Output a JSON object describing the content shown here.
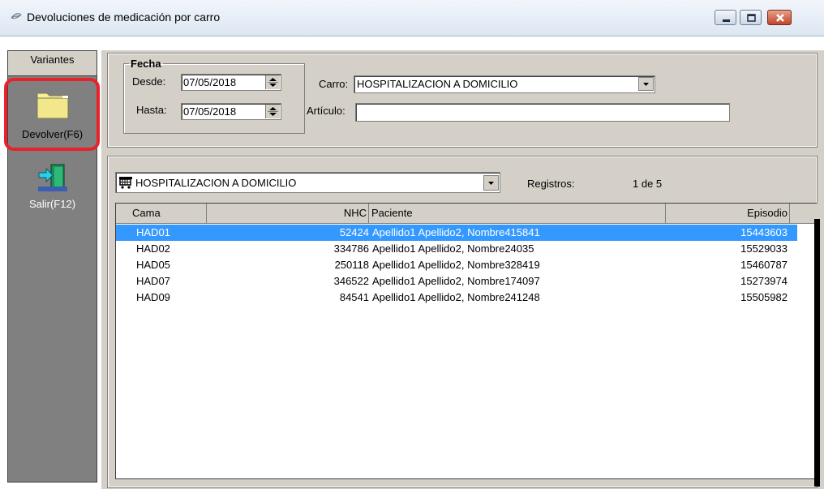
{
  "window": {
    "title": "Devoluciones de medicación por carro",
    "controls": {
      "minimize": "minimize-icon",
      "maximize": "maximize-icon",
      "close": "close-icon"
    }
  },
  "toolbar": {
    "tab_label": "Variantes",
    "devolver_label": "Devolver(F6)",
    "salir_label": "Salir(F12)"
  },
  "filters": {
    "fecha_legend": "Fecha",
    "desde_label": "Desde:",
    "desde_value": "07/05/2018",
    "hasta_label": "Hasta:",
    "hasta_value": "07/05/2018",
    "carro_label": "Carro:",
    "carro_value": "HOSPITALIZACION A DOMICILIO",
    "articulo_label": "Artículo:",
    "articulo_value": ""
  },
  "list": {
    "combo_value": "HOSPITALIZACION A DOMICILIO",
    "registros_label": "Registros:",
    "registros_value": "1 de 5",
    "columns": [
      "Cama",
      "NHC",
      "Paciente",
      "Episodio"
    ],
    "rows": [
      {
        "cama": "HAD01",
        "nhc": "52424",
        "paciente": "Apellido1 Apellido2, Nombre415841",
        "episodio": "15443603",
        "selected": true
      },
      {
        "cama": "HAD02",
        "nhc": "334786",
        "paciente": "Apellido1 Apellido2, Nombre24035",
        "episodio": "15529033",
        "selected": false
      },
      {
        "cama": "HAD05",
        "nhc": "250118",
        "paciente": "Apellido1 Apellido2, Nombre328419",
        "episodio": "15460787",
        "selected": false
      },
      {
        "cama": "HAD07",
        "nhc": "346522",
        "paciente": "Apellido1 Apellido2, Nombre174097",
        "episodio": "15273974",
        "selected": false
      },
      {
        "cama": "HAD09",
        "nhc": "84541",
        "paciente": "Apellido1 Apellido2, Nombre241248",
        "episodio": "15505982",
        "selected": false
      }
    ]
  },
  "colors": {
    "selection": "#3399ff",
    "panel": "#d4d0c8",
    "toolbar": "#808080",
    "highlight": "#e8212b"
  }
}
